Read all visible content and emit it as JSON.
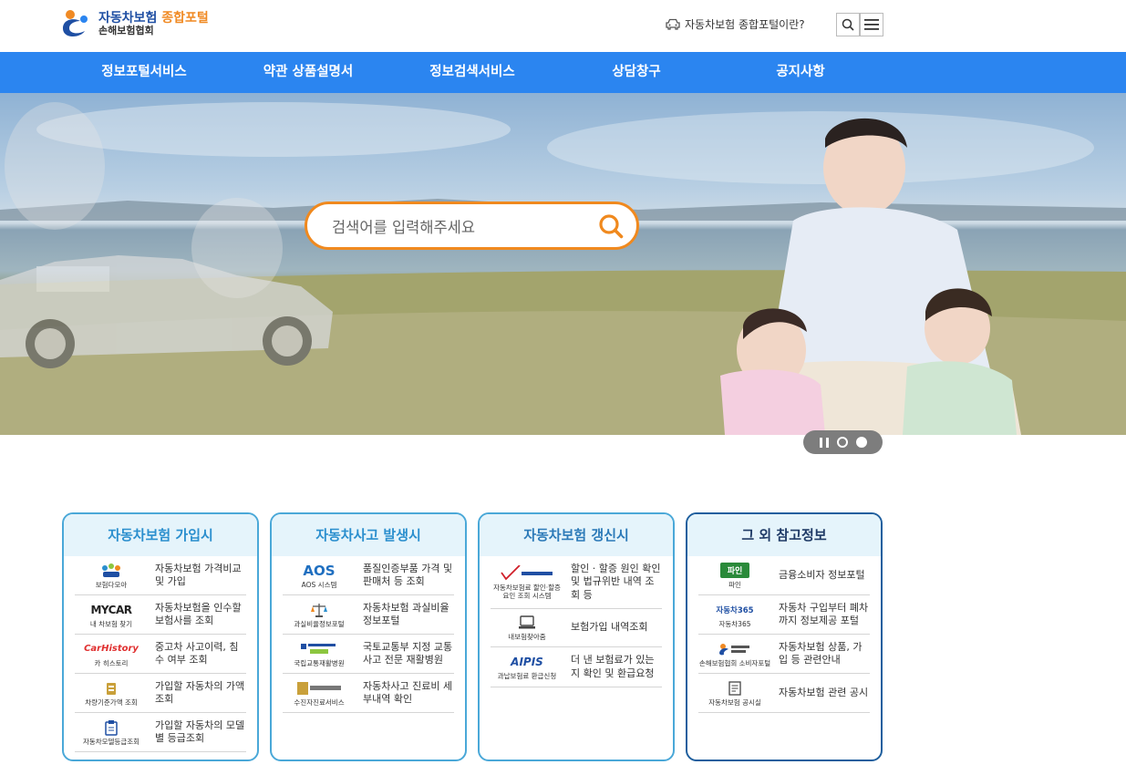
{
  "header": {
    "logo_title_a": "자동차보험",
    "logo_title_b": "종합포털",
    "logo_sub": "손해보험협회",
    "portal_link": "자동차보험 종합포털이란?"
  },
  "nav": {
    "items": [
      "정보포털서비스",
      "약관 상품설명서",
      "정보검색서비스",
      "상담창구",
      "공지사항"
    ]
  },
  "search": {
    "placeholder": "검색어를 입력해주세요"
  },
  "panels": [
    {
      "title": "자동차보험 가입시",
      "rows": [
        {
          "logo": "",
          "caption": "보험다모아",
          "text": "자동차보험 가격비교 및 가입"
        },
        {
          "logo": "MYCAR",
          "caption": "내 차보험 찾기",
          "text": "자동차보험을 인수할 보험사를 조회"
        },
        {
          "logo": "CarHistory",
          "caption": "카 히스토리",
          "text": "중고차 사고이력, 침수 여부 조회"
        },
        {
          "logo": "",
          "caption": "차량기준가액 조회",
          "text": "가입할 자동차의 가액 조회"
        },
        {
          "logo": "",
          "caption": "자동차모델등급조회",
          "text": "가입할 자동차의 모델별 등급조회"
        }
      ]
    },
    {
      "title": "자동차사고 발생시",
      "rows": [
        {
          "logo": "AOS",
          "caption": "AOS 시스템",
          "text": "품질인증부품 가격 및 판매처 등 조회"
        },
        {
          "logo": "",
          "caption": "과실비율정보포털",
          "text": "자동차보험 과실비율 정보포털"
        },
        {
          "logo": "",
          "caption": "국립교통재활병원",
          "text": "국토교통부 지정 교통사고 전문 재활병원"
        },
        {
          "logo": "",
          "caption": "수진자진료서비스",
          "text": "자동차사고 진료비 세부내역 확인"
        }
      ]
    },
    {
      "title": "자동차보험 갱신시",
      "rows": [
        {
          "logo": "",
          "caption": "자동차보험료 할인·할증 요인 조회 시스템",
          "text": "할인 · 할증 원인 확인 및 법규위반 내역 조회 등"
        },
        {
          "logo": "",
          "caption": "내보험찾아줌",
          "text": "보험가입 내역조회"
        },
        {
          "logo": "AIPIS",
          "caption": "과납보험료 환급신청",
          "text": "더 낸 보험료가 있는지 확인 및 환급요청"
        }
      ]
    },
    {
      "title": "그 외 참고정보",
      "rows": [
        {
          "logo": "파인",
          "caption": "파인",
          "text": "금융소비자 정보포털"
        },
        {
          "logo": "자동차365",
          "caption": "자동차365",
          "text": "자동차 구입부터 폐차까지 정보제공 포털"
        },
        {
          "logo": "",
          "caption": "손해보험협회 소비자포털",
          "text": "자동차보험 상품, 가입 등 관련안내"
        },
        {
          "logo": "",
          "caption": "자동차보험 공시실",
          "text": "자동차보험 관련 공시"
        }
      ]
    }
  ],
  "colors": {
    "nav_bg": "#2b85f0",
    "search_border": "#f0891e",
    "panel_border": "#4aa8d8",
    "panel_border_dark": "#1f5f9e"
  }
}
